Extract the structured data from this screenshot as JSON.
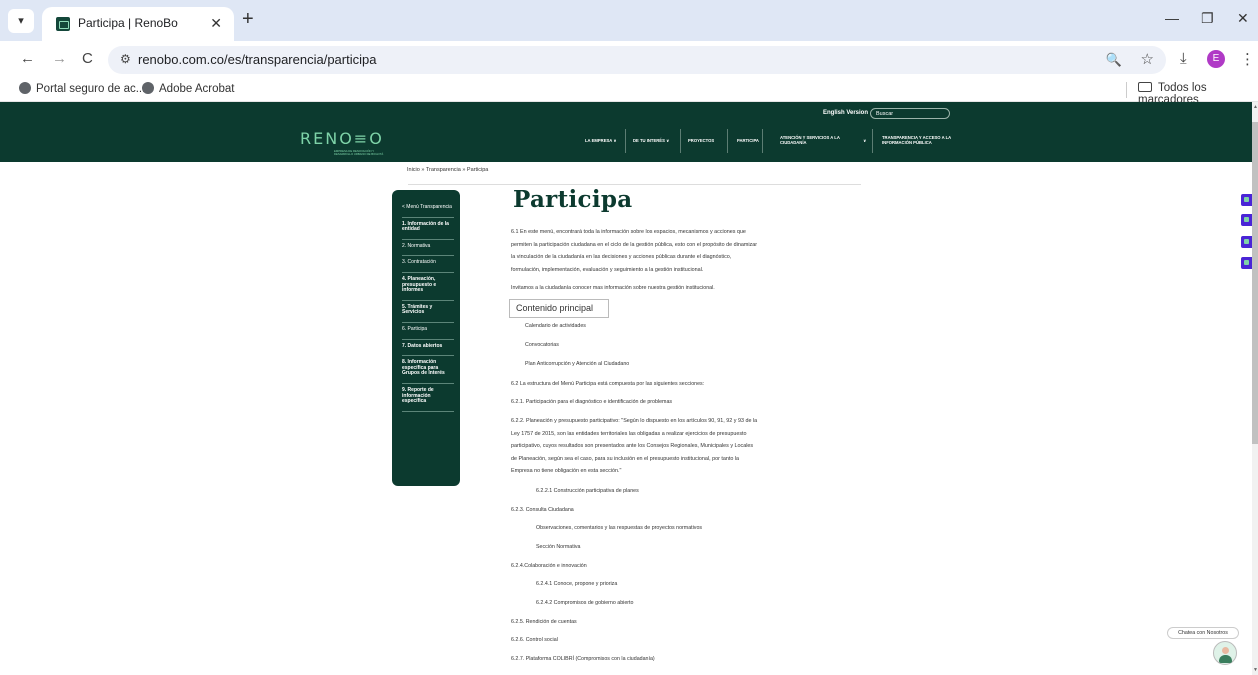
{
  "browser": {
    "tab_title": "Participa | RenoBo",
    "url": "renobo.com.co/es/transparencia/participa",
    "bookmarks": [
      "Portal seguro de ac...",
      "Adobe Acrobat"
    ],
    "all_bookmarks": "Todos los marcadores",
    "profile_initial": "E",
    "icons": {
      "tab_list": "▾",
      "close": "✕",
      "new_tab": "+",
      "minimize": "—",
      "restore": "❐",
      "back": "←",
      "forward": "→",
      "reload": "C",
      "site_info": "⚙",
      "zoom": "🔍",
      "star": "☆",
      "download": "⤓",
      "menu": "⋮"
    }
  },
  "header": {
    "english_version": "English Version",
    "search_placeholder": "Buscar",
    "logo_text": "RENO≡O",
    "logo_subtitle": "EMPRESA DE RENOVACIÓN Y DESARROLLO URBANO DE BOGOTÁ",
    "menu": [
      {
        "label": "LA EMPRESA ∨"
      },
      {
        "label": "DE TU INTERÉS ∨"
      },
      {
        "label": "PROYECTOS"
      },
      {
        "label": "PARTICIPA"
      },
      {
        "label": "ATENCIÓN Y SERVICIOS A LA CIUDADANÍA"
      },
      {
        "label": "∨"
      },
      {
        "label": "TRANSPARENCIA Y ACCESO A LA INFORMACIÓN PÚBLICA"
      }
    ]
  },
  "breadcrumb": "Inicio  »  Transparencia  »  Participa",
  "sidebar": [
    "< Menú Transparencia",
    "1. Información de la entidad",
    "2. Normativa",
    "3. Contratación",
    "4. Planeación, presupuesto e informes",
    "5. Trámites y Servicios",
    "6. Participa",
    "7. Datos abiertos",
    "8. Información específica para Grupos de Interés",
    "9. Reporte de información específica"
  ],
  "main": {
    "title": "Participa",
    "intro": [
      "6.1 En este menú, encontrará toda la información sobre los espacios, mecanismos y acciones que",
      "permiten la participación ciudadana en el ciclo de la gestión pública, esto con el propósito de dinamizar",
      "la vinculación de la ciudadanía en las decisiones y acciones públicas durante el diagnóstico,",
      "formulación, implementación, evaluación y seguimiento a la gestión institucional."
    ],
    "invite": "Invitamos a la ciudadanía  conocer mas información sobre nuestra gestión institucional.",
    "contenido_principal": "Contenido principal",
    "links": [
      "Calendario de actividades",
      "Convocatorias",
      "Plan Anticorrupción y Atención al Ciudadano"
    ],
    "structure_intro": "6.2 La estructura del Menú Participa está compuesta por las siguientes secciones:",
    "s621": "6.2.1. Participación para el diagnóstico e identificación de problemas",
    "s622": [
      "6.2.2. Planeación y presupuesto participativo: \"Según lo dispuesto en los artículos 90, 91, 92 y 93 de la",
      "Ley 1757 de 2015, son las entidades territoriales las obligadas a realizar ejercicios de presupuesto",
      "participativo, cuyos resultados son presentados ante los Consejos Regionales, Municipales y Locales",
      "de Planeación, según sea el caso, para su inclusión en el presupuesto institucional, por tanto la",
      "Empresa no tiene obligación en esta sección.\""
    ],
    "s6221": "6.2.2.1 Construcción participativa de planes",
    "s623": "6.2.3. Consulta Ciudadana",
    "s623_items": [
      "Observaciones, comentarios y las respuestas de proyectos normativos",
      "Sección Normativa"
    ],
    "s624": "6.2.4.Colaboración e innovación",
    "s6241": "6.2.4.1 Conoce, propone y prioriza",
    "s6242": "6.2.4.2 Compromisos de gobierno abierto",
    "s625": "6.2.5. Rendición de cuentas",
    "s626": "6.2.6. Control social",
    "s627": "6.2.7. Plataforma COLIBRÍ (Compromisos con la ciudadanía)"
  },
  "chat": {
    "label": "Chatea con Nosotros"
  }
}
